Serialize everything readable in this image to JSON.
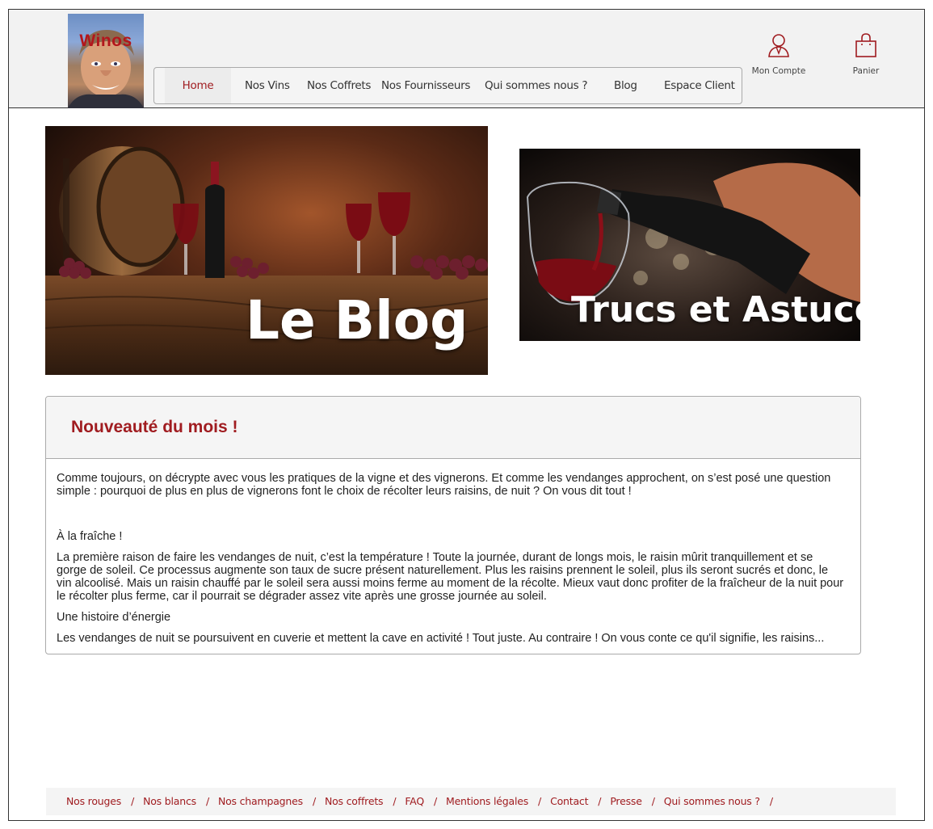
{
  "brand": {
    "logo_text": "Winos"
  },
  "nav": {
    "items": [
      {
        "label": "Home",
        "active": true
      },
      {
        "label": "Nos Vins"
      },
      {
        "label": "Nos Coffrets"
      },
      {
        "label": "Nos Fournisseurs"
      },
      {
        "label": "Qui sommes nous ?"
      },
      {
        "label": "Blog"
      },
      {
        "label": "Espace Client"
      }
    ]
  },
  "account": {
    "label": "Mon Compte",
    "icon": "user-icon"
  },
  "cart": {
    "label": "Panier",
    "icon": "shopping-bag-icon"
  },
  "banners": {
    "blog_title": "Le Blog",
    "trucs_title": "Trucs et Astuces"
  },
  "article": {
    "title": "Nouveauté du mois !",
    "intro": "Comme toujours, on décrypte avec vous les pratiques de la vigne et des vignerons. Et comme les vendanges approchent, on s’est posé une question simple : pourquoi de plus en plus de vignerons font le choix de récolter leurs raisins, de nuit ? On vous dit tout !",
    "heading1": "À la fraîche !",
    "para1": "La première raison de faire les vendanges de nuit, c’est la température ! Toute la journée, durant de longs mois, le raisin mûrit tranquillement et se gorge de soleil. Ce processus augmente son taux de sucre présent naturellement. Plus les raisins prennent le soleil, plus ils seront sucrés et donc, le vin alcoolisé. Mais un raisin chauffé par le soleil sera aussi moins ferme au moment de la récolte. Mieux vaut donc profiter de la fraîcheur de la nuit pour le récolter plus ferme, car il pourrait se dégrader assez vite après une grosse journée au soleil.",
    "heading2": "Une histoire d’énergie",
    "para2_cut": "Les vendanges de nuit se poursuivent en cuverie et mettent la cave en activité ! Tout juste. Au contraire ! On vous conte ce qu'il signifie, les raisins..."
  },
  "footer": {
    "links": [
      "Nos rouges",
      "Nos blancs",
      "Nos champagnes",
      "Nos coffrets",
      "FAQ",
      "Mentions légales",
      "Contact",
      "Presse",
      "Qui sommes nous ?"
    ],
    "separator": "/"
  },
  "colors": {
    "accent": "#a01c20",
    "header_bg": "#f2f2f2",
    "panel_head_bg": "#f5f5f5"
  }
}
